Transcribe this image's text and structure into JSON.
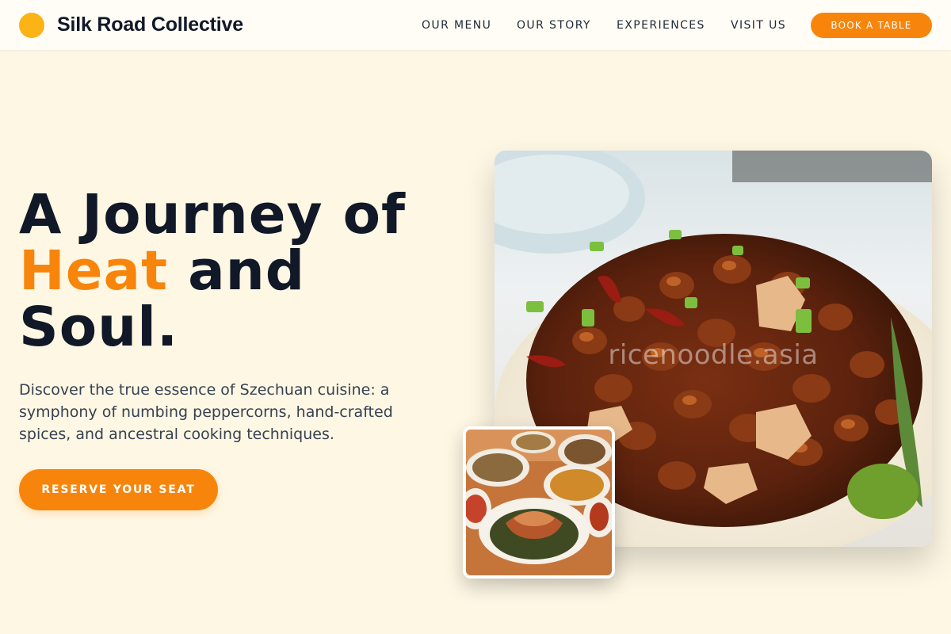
{
  "brand": {
    "name": "Silk Road Collective",
    "logo_color": "#fbb315"
  },
  "nav": {
    "items": [
      {
        "label": "OUR MENU"
      },
      {
        "label": "OUR STORY"
      },
      {
        "label": "EXPERIENCES"
      },
      {
        "label": "VISIT US"
      }
    ],
    "cta_label": "BOOK A TABLE"
  },
  "hero": {
    "title_line1": "A Journey of",
    "title_accent": "Heat",
    "title_line2_rest": " and",
    "title_line3": "Soul.",
    "description": "Discover the true essence of Szechuan cuisine: a symphony of numbing peppercorns, hand-crafted spices, and ancestral cooking techniques.",
    "cta_label": "RESERVE YOUR SEAT"
  },
  "images": {
    "main_watermark": "ricenoodle.asia"
  },
  "colors": {
    "accent": "#f8850b",
    "background": "#fef7e4",
    "text_dark": "#111827"
  }
}
